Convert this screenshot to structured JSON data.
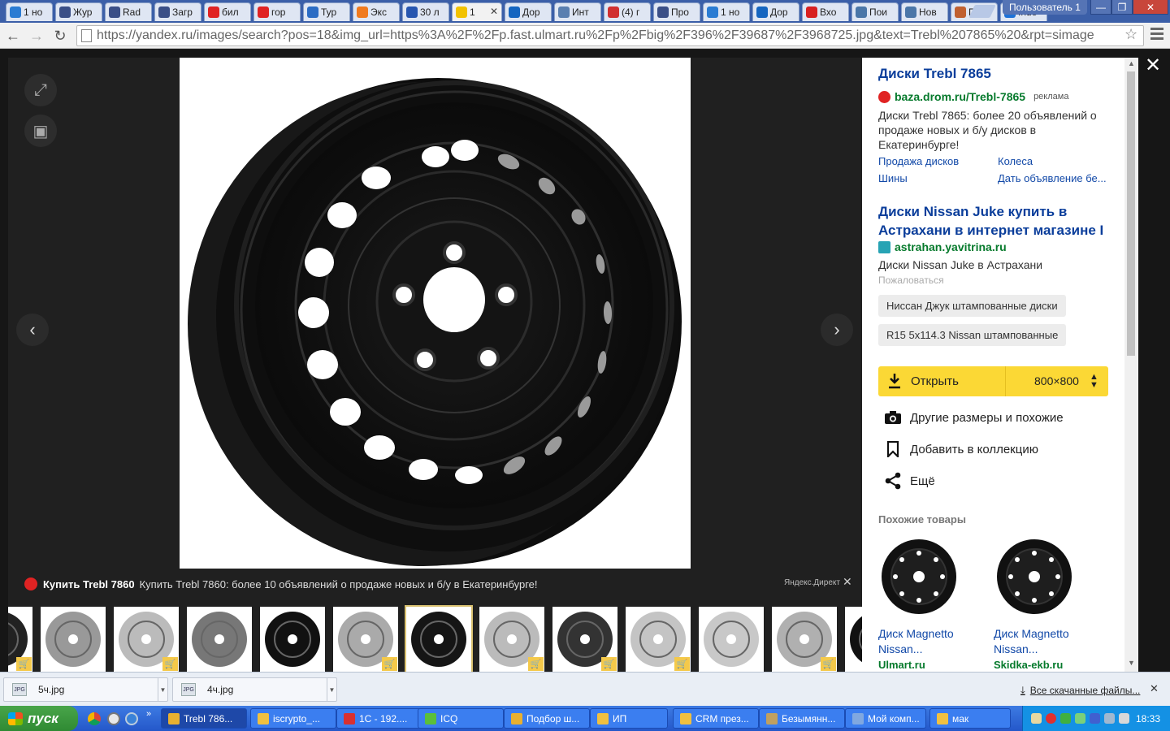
{
  "browser": {
    "tabs": [
      {
        "label": "1 но",
        "icon": "at-icon",
        "color": "#2b7cd3"
      },
      {
        "label": "Жур",
        "icon": "doc-icon",
        "color": "#3a4f87"
      },
      {
        "label": "Rad",
        "icon": "doc-icon",
        "color": "#3a4f87"
      },
      {
        "label": "Загр",
        "icon": "doc-icon",
        "color": "#3a4f87"
      },
      {
        "label": "бил",
        "icon": "yandex-icon",
        "color": "#e02323"
      },
      {
        "label": "гор",
        "icon": "yandex-icon",
        "color": "#e02323"
      },
      {
        "label": "Тур",
        "icon": "chart-icon",
        "color": "#2b6cc4"
      },
      {
        "label": "Экс",
        "icon": "fox-icon",
        "color": "#f07a1e"
      },
      {
        "label": "30 л",
        "icon": "b-icon",
        "color": "#2756b0"
      },
      {
        "label": "1",
        "icon": "images-icon",
        "color": "#f2c200",
        "active": true
      },
      {
        "label": "Дор",
        "icon": "lk-icon",
        "color": "#1565c0"
      },
      {
        "label": "Инт",
        "icon": "globe-icon",
        "color": "#5a7fb0"
      },
      {
        "label": "(4) г",
        "icon": "mail-icon",
        "color": "#d03030"
      },
      {
        "label": "Про",
        "icon": "doc-icon",
        "color": "#3a4f87"
      },
      {
        "label": "1 но",
        "icon": "at-icon",
        "color": "#2b7cd3"
      },
      {
        "label": "Дор",
        "icon": "lk-icon",
        "color": "#1565c0"
      },
      {
        "label": "Вхо",
        "icon": "n-icon",
        "color": "#d82020"
      },
      {
        "label": "Пои",
        "icon": "vk-icon",
        "color": "#4a76a8"
      },
      {
        "label": "Нов",
        "icon": "vk-icon",
        "color": "#4a76a8"
      },
      {
        "label": "Поч",
        "icon": "person-icon",
        "color": "#c06030"
      },
      {
        "label": "Inde",
        "icon": "globe-icon",
        "color": "#1d72d8"
      }
    ],
    "profile": "Пользователь 1",
    "url": "https://yandex.ru/images/search?pos=18&img_url=https%3A%2F%2Fp.fast.ulmart.ru%2Fp%2Fbig%2F396%2F39687%2F3968725.jpg&text=Trebl%207865%20&rpt=simage"
  },
  "ad_strip": {
    "title": "Купить Trebl 7860",
    "text": "Купить Trebl 7860: более 10 объявлений о продаже новых и б/у в Екатеринбурге!",
    "source": "Яндекс.Директ"
  },
  "thumbnails": [
    {
      "color": "#222",
      "cart": true
    },
    {
      "color": "#999",
      "cart": false
    },
    {
      "color": "#bbb",
      "cart": true
    },
    {
      "color": "#777",
      "cart": false
    },
    {
      "color": "#111",
      "cart": false
    },
    {
      "color": "#aaa",
      "cart": true
    },
    {
      "color": "#151515",
      "cart": false,
      "selected": true
    },
    {
      "color": "#bbb",
      "cart": true
    },
    {
      "color": "#333",
      "cart": true
    },
    {
      "color": "#c4c4c4",
      "cart": true
    },
    {
      "color": "#c8c8c8",
      "cart": false
    },
    {
      "color": "#b0b0b0",
      "cart": true
    },
    {
      "color": "#111",
      "cart": false
    }
  ],
  "sidebar": {
    "ad1": {
      "title": "Диски Trebl 7865",
      "url": "baza.drom.ru/Trebl-7865",
      "ad_label": "реклама",
      "text": "Диски Trebl 7865: более 20 объявлений о продаже новых и б/у дисков в Екатеринбурге!",
      "links": [
        "Продажа дисков",
        "Колеса",
        "Шины",
        "Дать объявление бе..."
      ]
    },
    "ad2": {
      "title": "Диски Nissan Juke купить в Астрахани в интернет магазине I",
      "url": "astrahan.yavitrina.ru",
      "text": "Диски Nissan Juke в Астрахани",
      "complain": "Пожаловаться"
    },
    "chips": [
      "Ниссан Джук штампованные диски",
      "R15 5x114.3 Nissan штампованные"
    ],
    "open_label": "Открыть",
    "size_label": "800×800",
    "actions": [
      "Другие размеры и похожие",
      "Добавить в коллекцию",
      "Ещё"
    ],
    "similar_title": "Похожие товары",
    "products": [
      {
        "name1": "Диск Magnetto",
        "name2": "Nissan...",
        "shop": "Ulmart.ru"
      },
      {
        "name1": "Диск Magnetto",
        "name2": "Nissan...",
        "shop": "Skidka-ekb.ru"
      }
    ]
  },
  "downloads": {
    "files": [
      "5ч.jpg",
      "4ч.jpg"
    ],
    "file_icon": "JPG",
    "show_all": "Все скачанные файлы..."
  },
  "taskbar": {
    "start": "пуск",
    "tasks": [
      {
        "label": "Trebl 786...",
        "color": "#e8b030",
        "active": true
      },
      {
        "label": "iscrypto_...",
        "color": "#f0c040"
      },
      {
        "label": "1С - 192....",
        "color": "#d83030"
      },
      {
        "label": "ICQ",
        "color": "#5bbf3a"
      },
      {
        "label": "Подбор ш...",
        "color": "#e8b030"
      },
      {
        "label": "ИП",
        "color": "#f0c040"
      },
      {
        "label": "CRM през...",
        "color": "#f0c040"
      },
      {
        "label": "Безымянн...",
        "color": "#c0a060"
      },
      {
        "label": "Мой комп...",
        "color": "#80a8e0"
      },
      {
        "label": "мак",
        "color": "#f0c040"
      }
    ],
    "clock": "18:33"
  }
}
